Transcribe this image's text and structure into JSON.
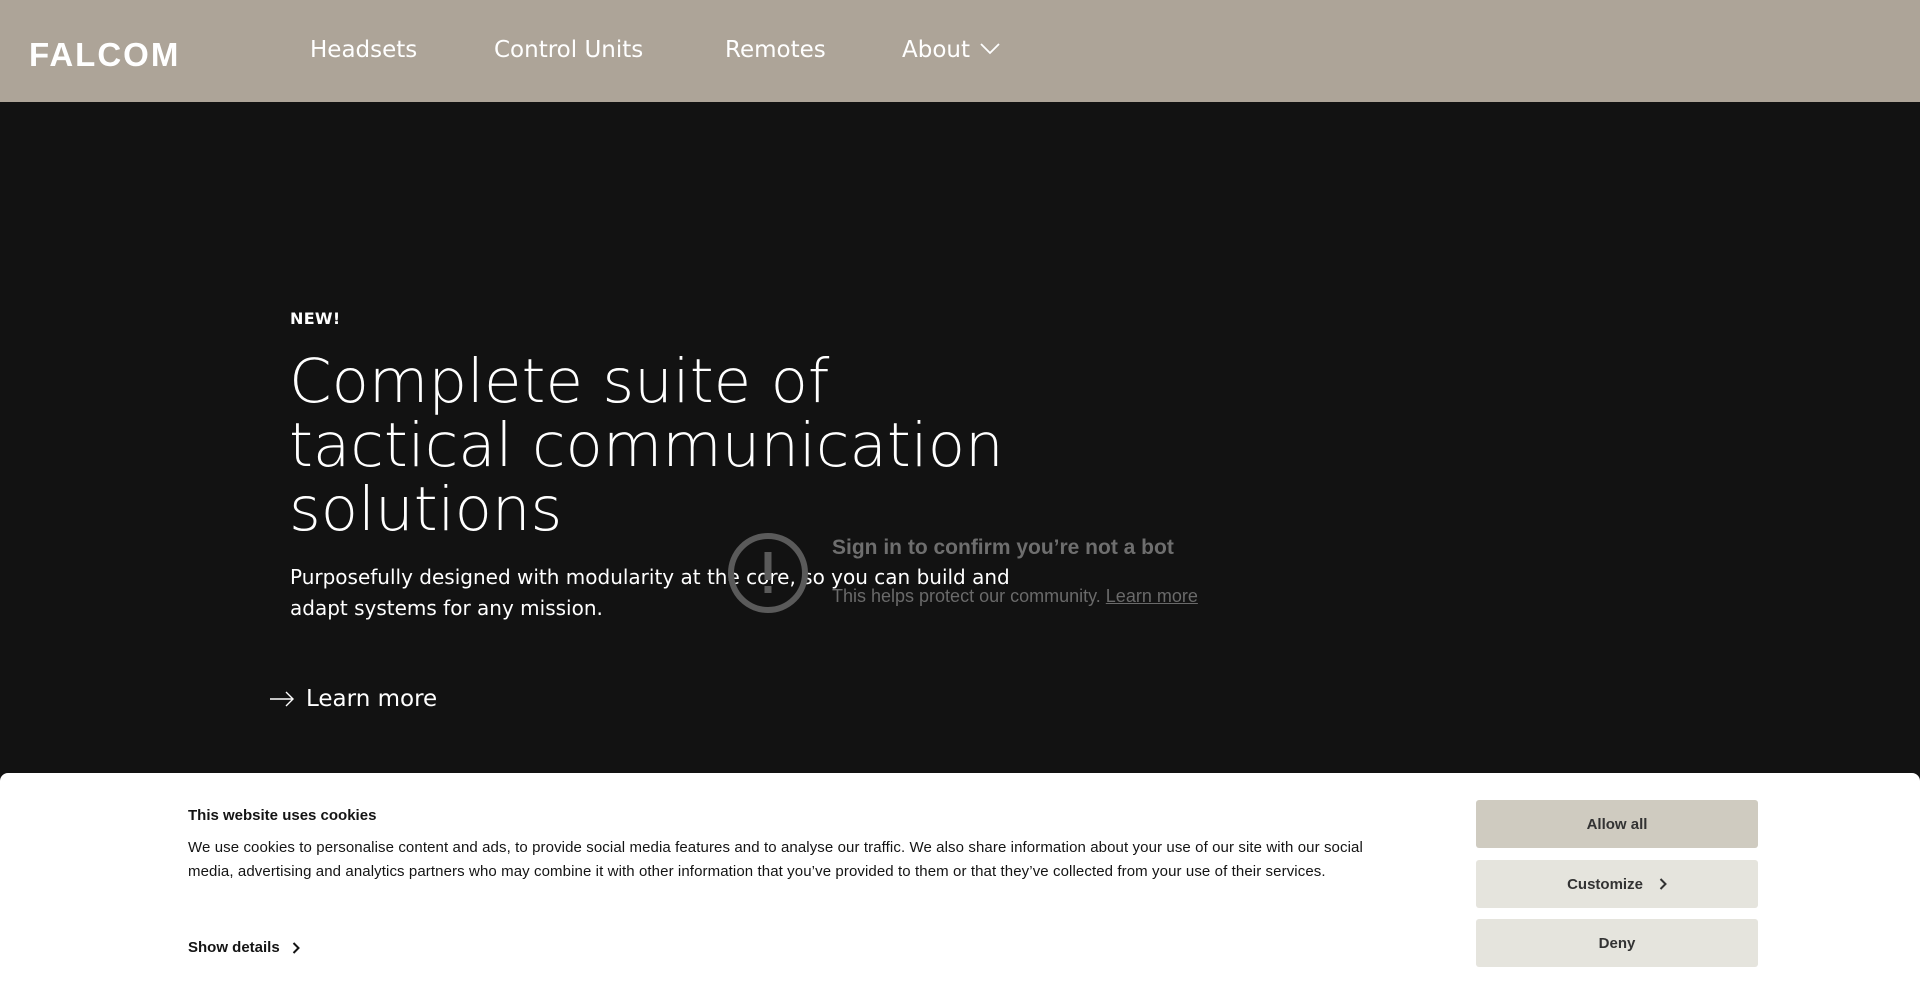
{
  "header": {
    "logo_text": "FALCOM",
    "nav": {
      "headsets": "Headsets",
      "control_units": "Control Units",
      "remotes": "Remotes",
      "about": "About"
    }
  },
  "hero": {
    "tag": "NEW!",
    "title_line1": "Complete suite of",
    "title_line2": "tactical communication",
    "title_line3": "solutions",
    "subtitle": "Purposefully designed with modularity at the core, so you can build and adapt systems for any mission.",
    "learn_more": "Learn more"
  },
  "video_notice": {
    "title": "Sign in to confirm you’re not a bot",
    "subtitle": "This helps protect our community.",
    "link": "Learn more"
  },
  "cookie_banner": {
    "title": "This website uses cookies",
    "text": "We use cookies to personalise content and ads, to provide social media features and to analyse our traffic. We also share information about your use of our site with our social media, advertising and analytics partners who may combine it with other information that you’ve provided to them or that they’ve collected from your use of their services.",
    "show_details": "Show details",
    "allow_all": "Allow all",
    "customize": "Customize",
    "deny": "Deny"
  },
  "colors": {
    "header_bg": "#ada498",
    "page_bg": "#121212",
    "allow_btn": "#cfcbc0",
    "secondary_btn": "#e5e4dd"
  }
}
